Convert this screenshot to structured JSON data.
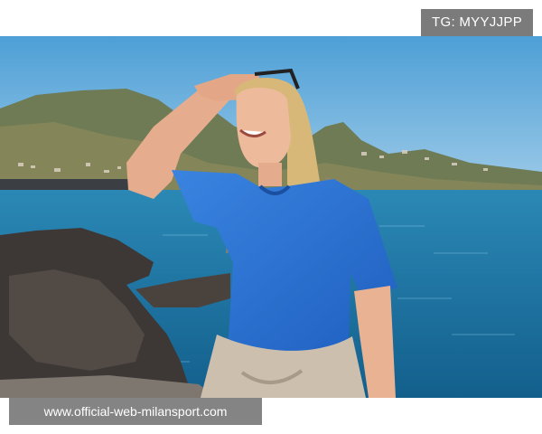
{
  "watermark": {
    "top_right_text": "TG: MYYJJPP",
    "bottom_left_text": "www.official-web-milansport.com"
  },
  "photo": {
    "subject": "woman-in-blue-tshirt-shading-eyes-by-sea",
    "colors": {
      "sky": "#5ea7d6",
      "sea": "#1f77a6",
      "tshirt": "#2a6fd1",
      "rocks": "#3a3634",
      "hair": "#d9b77a",
      "skin": "#eab595"
    }
  }
}
